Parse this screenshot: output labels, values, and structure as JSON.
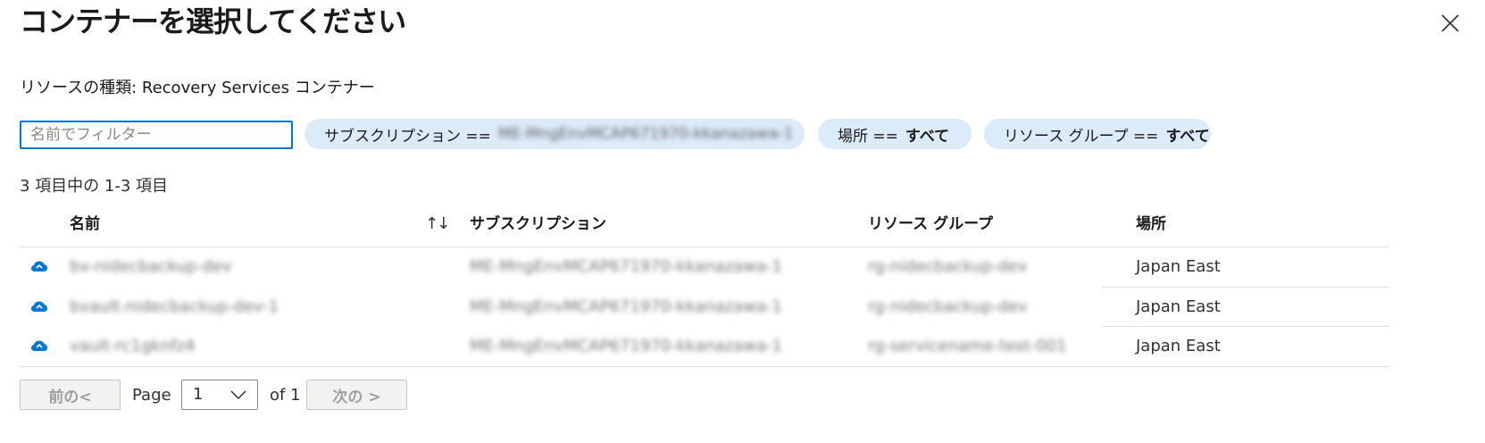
{
  "header": {
    "title": "コンテナーを選択してください"
  },
  "resource_type": "リソースの種類: Recovery Services コンテナー",
  "filters": {
    "search_placeholder": "名前でフィルター",
    "subscription_label": "サブスクリプション ==",
    "subscription_value": "ME-MngEnvMCAP671970-kkanazawa-1",
    "location_label": "場所 ==",
    "location_value": "すべて",
    "resource_group_label": "リソース グループ ==",
    "resource_group_value": "すべて"
  },
  "count_text": "3 項目中の 1-3 項目",
  "table": {
    "headers": {
      "name": "名前",
      "subscription": "サブスクリプション",
      "resource_group": "リソース グループ",
      "location": "場所"
    },
    "sort_icon": "↑↓",
    "rows": [
      {
        "name": "bv-nidecbackup-dev",
        "subscription": "ME-MngEnvMCAP671970-kkanazawa-1",
        "resource_group": "rg-nidecbackup-dev",
        "location": "Japan East"
      },
      {
        "name": "bvault-nidecbackup-dev-1",
        "subscription": "ME-MngEnvMCAP671970-kkanazawa-1",
        "resource_group": "rg-nidecbackup-dev",
        "location": "Japan East"
      },
      {
        "name": "vault-rc1gknfz4",
        "subscription": "ME-MngEnvMCAP671970-kkanazawa-1",
        "resource_group": "rg-servicename-test-001",
        "location": "Japan East"
      }
    ]
  },
  "pagination": {
    "prev_label": "前の<",
    "page_label": "Page",
    "page_value": "1",
    "of_label": "of 1",
    "next_label": "次の >"
  },
  "icons": {
    "close": "close-icon",
    "vault": "recovery-vault-icon",
    "chevron": "chevron-down-icon"
  },
  "colors": {
    "accent": "#0078d4",
    "pill_bg": "#dcebfa",
    "vault_icon": "#0078d4"
  }
}
